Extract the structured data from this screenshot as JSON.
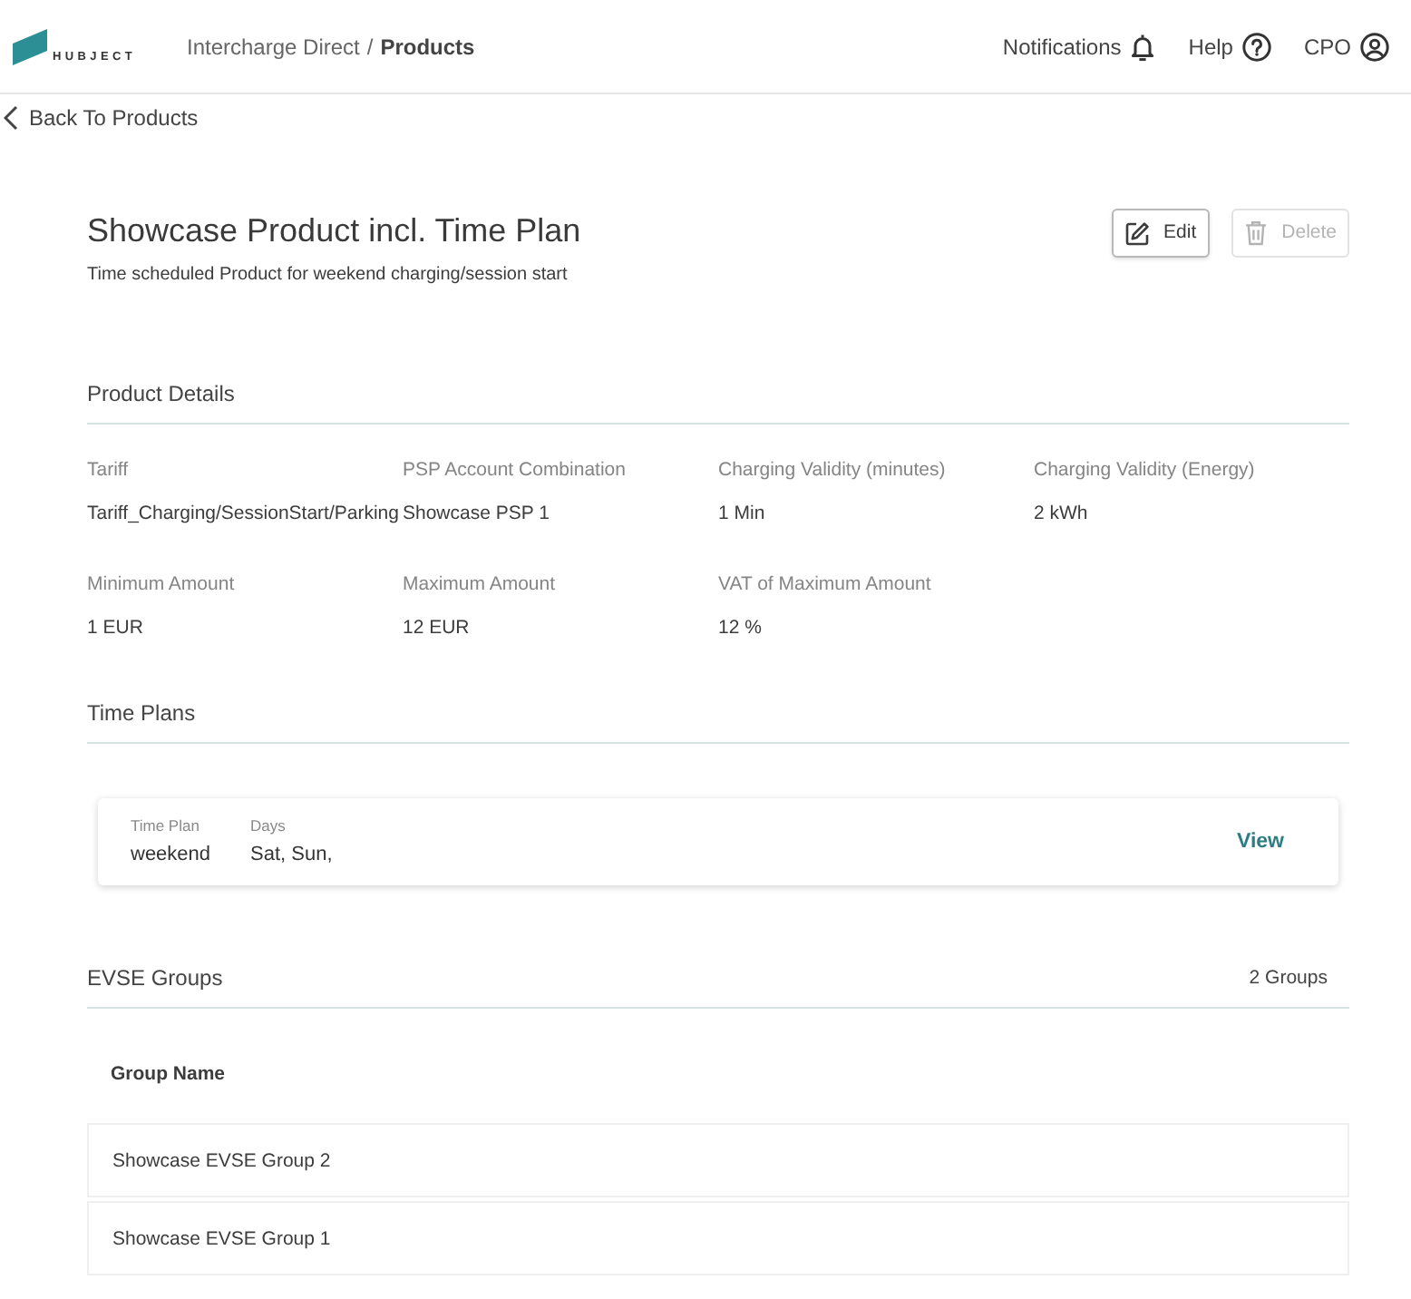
{
  "header": {
    "logo": {
      "wordmark": "HUBJECT"
    },
    "breadcrumb": [
      {
        "label": "Intercharge Direct",
        "current": false
      },
      {
        "label": "Products",
        "current": true
      }
    ],
    "breadcrumb_separator": "/",
    "menu": [
      {
        "label": "Notifications",
        "kind": "bell"
      },
      {
        "label": "Help",
        "kind": "help"
      },
      {
        "label": "CPO",
        "kind": "user"
      }
    ]
  },
  "back_link": {
    "label": "Back To Products"
  },
  "product": {
    "title": "Showcase Product incl. Time Plan",
    "description": "Time scheduled Product for weekend charging/session start",
    "actions": [
      {
        "label": "Edit",
        "kind": "edit",
        "disabled": false
      },
      {
        "label": "Delete",
        "kind": "delete",
        "disabled": true
      }
    ]
  },
  "product_details": {
    "heading": "Product Details",
    "fields": [
      {
        "label": "Tariff",
        "value": "Tariff_Charging/SessionStart/Parking"
      },
      {
        "label": "PSP Account Combination",
        "value": "Showcase PSP 1"
      },
      {
        "label": "Charging Validity (minutes)",
        "value": "1 Min"
      },
      {
        "label": "Charging Validity (Energy)",
        "value": "2 kWh"
      },
      {
        "label": "Minimum Amount",
        "value": "1 EUR"
      },
      {
        "label": "Maximum Amount",
        "value": "12 EUR"
      },
      {
        "label": "VAT of Maximum Amount",
        "value": "12 %"
      }
    ]
  },
  "time_plans": {
    "heading": "Time Plans",
    "items": [
      {
        "name_label": "Time Plan",
        "name": "weekend",
        "days_label": "Days",
        "days": "Sat, Sun,",
        "action": "View"
      }
    ]
  },
  "evse_groups": {
    "heading": "EVSE Groups",
    "count": "2 Groups",
    "columns": [
      "Group Name"
    ],
    "rows": [
      [
        "Showcase EVSE Group 2"
      ],
      [
        "Showcase EVSE Group 1"
      ]
    ]
  }
}
